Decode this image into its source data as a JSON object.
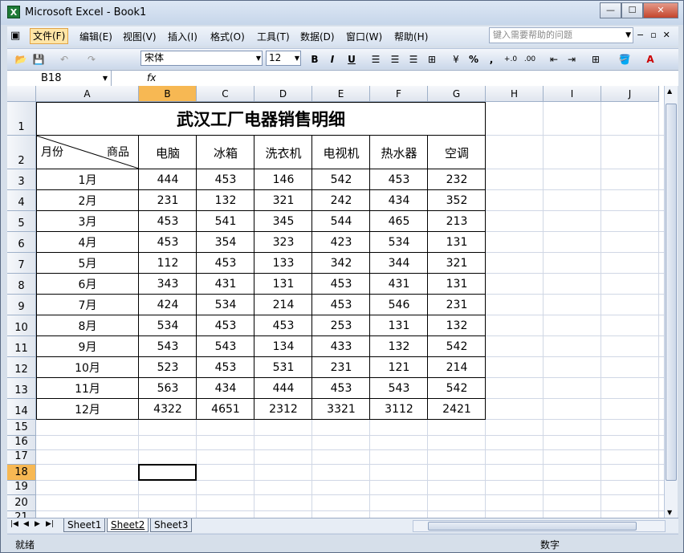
{
  "window": {
    "title": "Microsoft Excel - Book1",
    "app_icon": "excel-icon",
    "min": "—",
    "max": "☐",
    "close": "✕"
  },
  "menu": {
    "items": [
      "文件(F)",
      "编辑(E)",
      "视图(V)",
      "插入(I)",
      "格式(O)",
      "工具(T)",
      "数据(D)",
      "窗口(W)",
      "帮助(H)"
    ],
    "help_placeholder": "键入需要帮助的问题"
  },
  "toolbar": {
    "font": "宋体",
    "size": "12",
    "bold": "B",
    "italic": "I",
    "underline": "U",
    "percent": "%",
    "comma": ","
  },
  "formula": {
    "name_box": "B18",
    "fx": "fx",
    "content": ""
  },
  "columns": [
    "A",
    "B",
    "C",
    "D",
    "E",
    "F",
    "G",
    "H",
    "I",
    "J"
  ],
  "rows": [
    "1",
    "2",
    "3",
    "4",
    "5",
    "6",
    "7",
    "8",
    "9",
    "10",
    "11",
    "12",
    "13",
    "14",
    "15",
    "16",
    "17",
    "18",
    "19",
    "20",
    "21"
  ],
  "table": {
    "title": "武汉工厂电器销售明细",
    "corner_left": "月份",
    "corner_right": "商品",
    "headers": [
      "电脑",
      "冰箱",
      "洗衣机",
      "电视机",
      "热水器",
      "空调"
    ],
    "rows": [
      {
        "m": "1月",
        "v": [
          "444",
          "453",
          "146",
          "542",
          "453",
          "232"
        ]
      },
      {
        "m": "2月",
        "v": [
          "231",
          "132",
          "321",
          "242",
          "434",
          "352"
        ]
      },
      {
        "m": "3月",
        "v": [
          "453",
          "541",
          "345",
          "544",
          "465",
          "213"
        ]
      },
      {
        "m": "4月",
        "v": [
          "453",
          "354",
          "323",
          "423",
          "534",
          "131"
        ]
      },
      {
        "m": "5月",
        "v": [
          "112",
          "453",
          "133",
          "342",
          "344",
          "321"
        ]
      },
      {
        "m": "6月",
        "v": [
          "343",
          "431",
          "131",
          "453",
          "431",
          "131"
        ]
      },
      {
        "m": "7月",
        "v": [
          "424",
          "534",
          "214",
          "453",
          "546",
          "231"
        ]
      },
      {
        "m": "8月",
        "v": [
          "534",
          "453",
          "453",
          "253",
          "131",
          "132"
        ]
      },
      {
        "m": "9月",
        "v": [
          "543",
          "543",
          "134",
          "433",
          "132",
          "542"
        ]
      },
      {
        "m": "10月",
        "v": [
          "523",
          "453",
          "531",
          "231",
          "121",
          "214"
        ]
      },
      {
        "m": "11月",
        "v": [
          "563",
          "434",
          "444",
          "453",
          "543",
          "542"
        ]
      },
      {
        "m": "12月",
        "v": [
          "4322",
          "4651",
          "2312",
          "3321",
          "3112",
          "2421"
        ]
      }
    ]
  },
  "sheets": [
    "Sheet1",
    "Sheet2",
    "Sheet3"
  ],
  "active_sheet": "Sheet2",
  "status": {
    "left": "就绪",
    "right": "数字"
  }
}
